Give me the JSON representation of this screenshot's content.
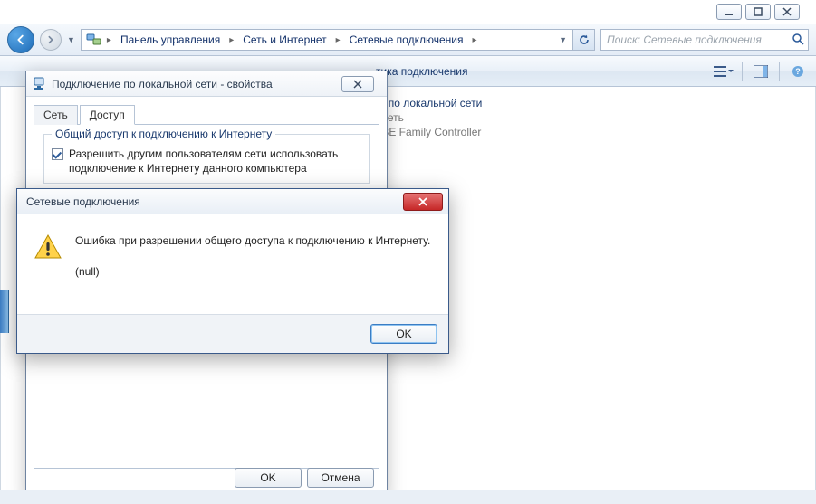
{
  "window": {
    "min_tip": "Свернуть",
    "max_tip": "Развернуть",
    "close_tip": "Закрыть"
  },
  "breadcrumb": {
    "items": [
      "Панель управления",
      "Сеть и Интернет",
      "Сетевые подключения"
    ]
  },
  "search": {
    "placeholder": "Поиск: Сетевые подключения"
  },
  "toolbar": {
    "diagnostics": "тика подключения"
  },
  "connection": {
    "name_fragment": "ие по локальной сети",
    "type_fragment": "я сеть",
    "adapter_fragment": "GBE Family Controller"
  },
  "props": {
    "title": "Подключение по локальной сети - свойства",
    "tabs": {
      "network": "Сеть",
      "sharing": "Доступ"
    },
    "group_title": "Общий доступ к подключению к Интернету",
    "allow_share": "Разрешить другим пользователям сети использовать подключение к Интернету данного компьютера",
    "ok": "OK",
    "cancel": "Отмена"
  },
  "msgbox": {
    "title": "Сетевые подключения",
    "line1": "Ошибка при разрешении общего доступа к подключению к Интернету.",
    "line2": "(null)",
    "ok": "OK"
  }
}
